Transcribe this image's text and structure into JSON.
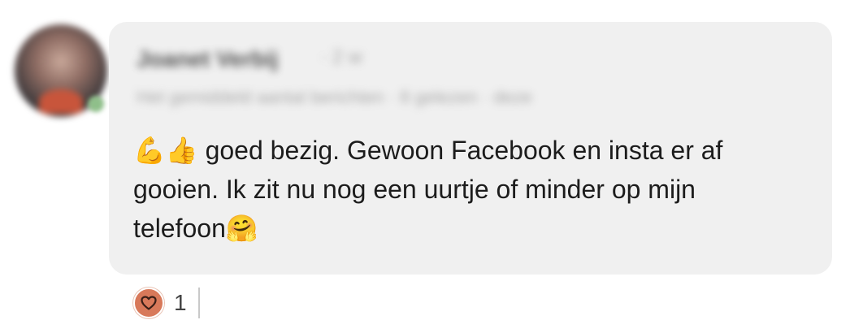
{
  "comment": {
    "author_name": "Joanet Verbij",
    "author_meta": "· 2 w",
    "author_subtitle": "Het gemiddeld aantal berichten · 8 gelezen · deze",
    "text_line1": " goed bezig. Gewoon Facebook en insta er af",
    "text_line2": "gooien. Ik zit nu nog een uurtje of minder op mijn",
    "text_line3": "telefoon",
    "emoji_lead": [
      "flexed-biceps",
      "thumbs-up"
    ],
    "emoji_trail": "hugging-face"
  },
  "reactions": {
    "icon": "heart-icon",
    "count": "1",
    "color": "#d8795a"
  },
  "colors": {
    "bubble": "#f0f0f0",
    "text": "#1c1c1c"
  }
}
